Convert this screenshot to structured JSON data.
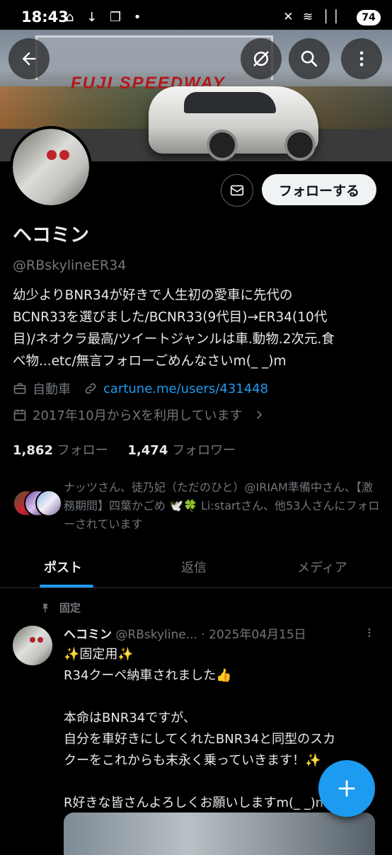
{
  "status_bar": {
    "time": "18:43",
    "left_icons": "⌂ ↓ ❐ •",
    "right_icons": "✕ ≋ ││",
    "battery": "74"
  },
  "banner": {
    "sign_text": "FUJI SPEEDWAY"
  },
  "profile": {
    "name": "ヘコミン",
    "handle": "@RBskylineER34",
    "bio_lines": [
      "幼少よりBNR34が好きで人生初の愛車に先代の",
      "BCNR33を選びました/BCNR33(9代目)→ER34(10代",
      "目)/ネオクラ最高/ツイートジャンルは車.動物.2次元.食",
      "べ物...etc/無言フォローごめんなさいm(_ _)m"
    ],
    "category": "自動車",
    "link": "cartune.me/users/431448",
    "joined": "2017年10月からXを利用しています",
    "following_count": "1,862",
    "following_label": "フォロー",
    "followers_count": "1,474",
    "followers_label": "フォロワー",
    "followed_by": "ナッツさん、徒乃妃（ただのひと）@IRIAM準備中さん、【激務期間】四葉かごめ 🕊️🍀 Li:startさん、他53人さんにフォローされています",
    "follow_button": "フォローする"
  },
  "tabs": [
    {
      "label": "ポスト",
      "active": true
    },
    {
      "label": "返信",
      "active": false
    },
    {
      "label": "メディア",
      "active": false
    }
  ],
  "post": {
    "pinned_label": "固定",
    "author_name": "ヘコミン",
    "author_handle": "@RBskyline...",
    "date": "· 2025年04月15日",
    "lines": [
      "✨固定用✨",
      "R34クーペ納車されました👍",
      "",
      "本命はBNR34ですが、",
      "自分を車好きにしてくれたBNR34と同型のスカ",
      "クーをこれからも末永く乗っていきます！✨",
      "",
      "R好きな皆さんよろしくお願いしますm(_ _)m"
    ],
    "more_icon": "more-icon"
  },
  "colors": {
    "accent": "#1d9bf0",
    "background": "#000000",
    "text": "#e7e9ea",
    "muted": "#71767b"
  }
}
